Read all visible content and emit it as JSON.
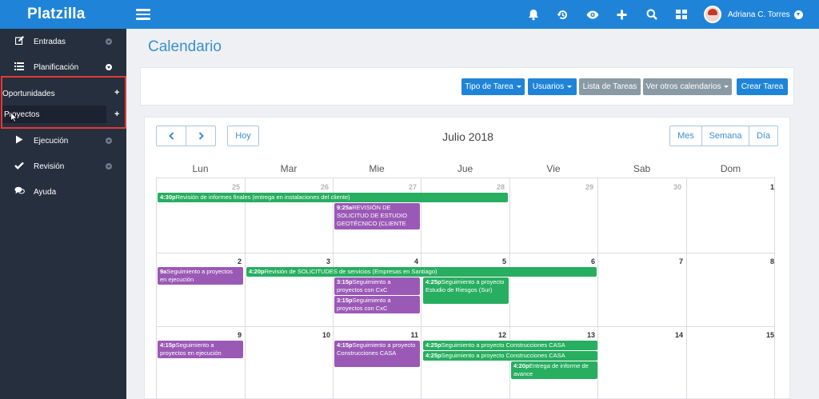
{
  "app": {
    "brand": "Platzilla"
  },
  "topbar": {
    "icons": [
      "bell-icon",
      "history-icon",
      "eye-icon",
      "plus-icon",
      "search-icon",
      "grid-icon"
    ],
    "user_name": "Adriana C. Torres"
  },
  "sidebar": {
    "items": [
      {
        "label": "Entradas",
        "icon": "edit-icon"
      },
      {
        "label": "Planificación",
        "icon": "list-icon"
      },
      {
        "label": "Ejecución",
        "icon": "play-icon"
      },
      {
        "label": "Revisión",
        "icon": "check-icon"
      },
      {
        "label": "Ayuda",
        "icon": "chat-icon"
      }
    ],
    "sub_items": [
      {
        "label": "Oportunidades"
      },
      {
        "label": "Proyectos"
      }
    ]
  },
  "page": {
    "title": "Calendario"
  },
  "toolbar": {
    "tipo_tarea": "Tipo de Tarea",
    "usuarios": "Usuarios",
    "lista_tareas": "Lista de Tareas",
    "otros_calendarios": "Ver otros calendarios",
    "crear_tarea": "Crear Tarea"
  },
  "calendar": {
    "prev": "‹",
    "next": "›",
    "today": "Hoy",
    "title": "Julio 2018",
    "views": [
      "Mes",
      "Semana",
      "Día"
    ],
    "day_headers": [
      "Lun",
      "Mar",
      "Mie",
      "Jue",
      "Vie",
      "Sab",
      "Dom"
    ],
    "weeks": [
      [
        "25",
        "26",
        "27",
        "28",
        "29",
        "30",
        "1"
      ],
      [
        "2",
        "3",
        "4",
        "5",
        "6",
        "7",
        "8"
      ],
      [
        "9",
        "10",
        "11",
        "12",
        "13",
        "14",
        "15"
      ]
    ],
    "events": [
      {
        "time": "4:30p",
        "title": "Revisión de informes finales (entrega en instalaciones del cliente)",
        "color": "green"
      },
      {
        "time": "9:25a",
        "title": "REVISIÓN DE SOLICITUD DE ESTUDIO GEOTÉCNICO (CLIENTE G2M)",
        "color": "purple"
      },
      {
        "time": "9a",
        "title": "Seguimiento a proyectos en ejecución",
        "color": "purple"
      },
      {
        "time": "4:20p",
        "title": "Revisión de SOLICITUDES de servicios (Empresas en Santiago)",
        "color": "green"
      },
      {
        "time": "3:15p",
        "title": "Seguimiento a proyectos con CxC",
        "color": "purple"
      },
      {
        "time": "3:15p",
        "title": "Seguimiento a proyectos con CxC",
        "color": "purple"
      },
      {
        "time": "4:25p",
        "title": "Seguimiento a proyecto Estudio de Riesgos (Sur)",
        "color": "green"
      },
      {
        "time": "4:15p",
        "title": "Seguimiento a proyectos en ejecución",
        "color": "purple"
      },
      {
        "time": "4:15p",
        "title": "Seguimiento a proyecto Construcciones CASA",
        "color": "purple"
      },
      {
        "time": "4:25p",
        "title": "Seguimiento a proyecto Construcciones CASA",
        "color": "green"
      },
      {
        "time": "4:25p",
        "title": "Seguimiento a proyecto Construcciones CASA",
        "color": "green"
      },
      {
        "time": "4:20p",
        "title": "Entrega de informe de avance",
        "color": "green"
      }
    ]
  },
  "colors": {
    "primary": "#1f84d8",
    "sidebar": "#252f3e",
    "green": "#27ae60",
    "purple": "#9b59b6",
    "highlight": "#e53935"
  }
}
